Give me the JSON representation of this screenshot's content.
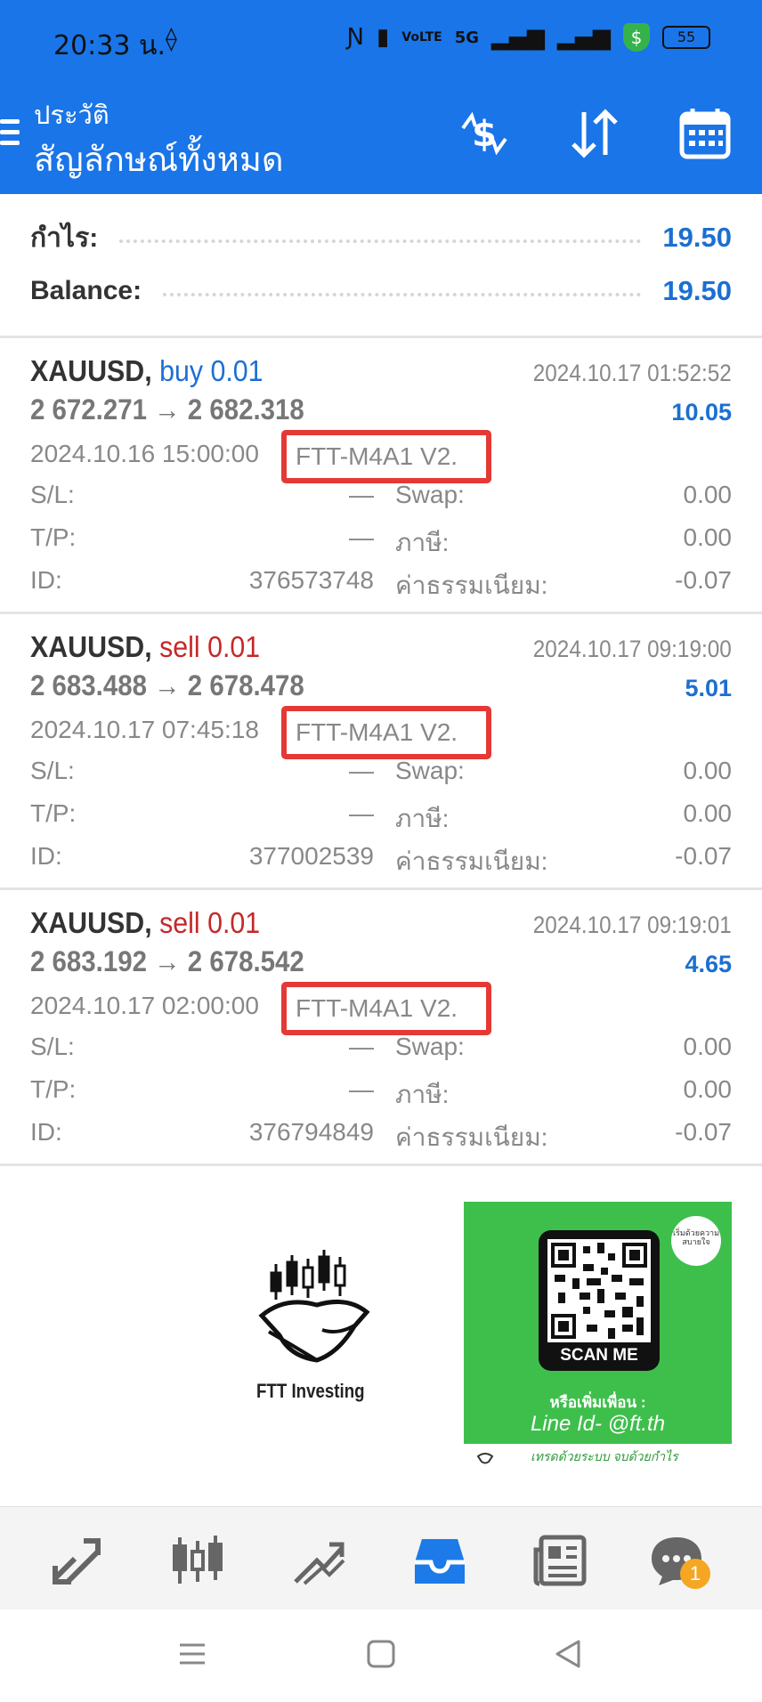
{
  "status_bar": {
    "time": "20:33 น.",
    "network_label": "VoLTE",
    "signal_label": "5G",
    "battery": "55"
  },
  "header": {
    "subtitle": "ประวัติ",
    "title": "สัญลักษณ์ทั้งหมด",
    "icons": [
      "deposit-dollar-icon",
      "sort-icon",
      "calendar-icon"
    ]
  },
  "summary": {
    "profit_label": "กำไร:",
    "profit_value": "19.50",
    "balance_label": "Balance:",
    "balance_value": "19.50"
  },
  "deals": [
    {
      "symbol": "XAUUSD,",
      "type": "buy 0.01",
      "close_time": "2024.10.17 01:52:52",
      "prices": "2 672.271 → 2 682.318",
      "profit": "10.05",
      "open_time": "2024.10.16 15:00:00",
      "comment": "FTT-M4A1 V2.",
      "sl_label": "S/L:",
      "sl_value": "—",
      "tp_label": "T/P:",
      "tp_value": "—",
      "id_label": "ID:",
      "id_value": "376573748",
      "swap_label": "Swap:",
      "swap_value": "0.00",
      "tax_label": "ภาษี:",
      "tax_value": "0.00",
      "fee_label": "ค่าธรรมเนียม:",
      "fee_value": "-0.07"
    },
    {
      "symbol": "XAUUSD,",
      "type": "sell 0.01",
      "close_time": "2024.10.17 09:19:00",
      "prices": "2 683.488 → 2 678.478",
      "profit": "5.01",
      "open_time": "2024.10.17 07:45:18",
      "comment": "FTT-M4A1 V2.",
      "sl_label": "S/L:",
      "sl_value": "—",
      "tp_label": "T/P:",
      "tp_value": "—",
      "id_label": "ID:",
      "id_value": "377002539",
      "swap_label": "Swap:",
      "swap_value": "0.00",
      "tax_label": "ภาษี:",
      "tax_value": "0.00",
      "fee_label": "ค่าธรรมเนียม:",
      "fee_value": "-0.07"
    },
    {
      "symbol": "XAUUSD,",
      "type": "sell 0.01",
      "close_time": "2024.10.17 09:19:01",
      "prices": "2 683.192 → 2 678.542",
      "profit": "4.65",
      "open_time": "2024.10.17 02:00:00",
      "comment": "FTT-M4A1 V2.",
      "sl_label": "S/L:",
      "sl_value": "—",
      "tp_label": "T/P:",
      "tp_value": "—",
      "id_label": "ID:",
      "id_value": "376794849",
      "swap_label": "Swap:",
      "swap_value": "0.00",
      "tax_label": "ภาษี:",
      "tax_value": "0.00",
      "fee_label": "ค่าธรรมเนียม:",
      "fee_value": "-0.07"
    }
  ],
  "ad": {
    "logo_text": "FTT Investing",
    "scan_label": "SCAN ME",
    "bubble_text": "เริ่มด้วยความสบายใจ",
    "add_friend": "หรือเพิ่มเพื่อน :",
    "line_id": "Line Id- @ft.th",
    "tagline": "เทรดด้วยระบบ จบด้วยกำไร"
  },
  "bottom_nav": {
    "items": [
      "quotes-icon",
      "chart-icon",
      "trade-icon",
      "history-icon",
      "news-icon",
      "chat-icon"
    ],
    "active_index": 3,
    "chat_badge": "1"
  },
  "colors": {
    "header_blue": "#1a75e8",
    "value_blue": "#1c6fd1",
    "sell_red": "#c62828",
    "highlight_red": "#e53935",
    "ad_green": "#3ebf4c"
  }
}
